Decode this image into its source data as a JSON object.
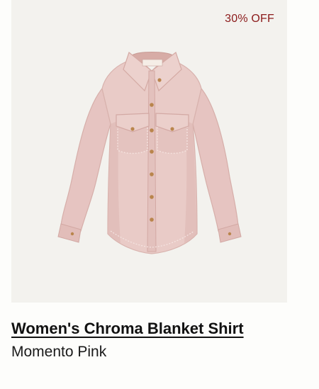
{
  "product": {
    "badge": "30% OFF",
    "title": "Women's Chroma Blanket Shirt",
    "color_name": "Momento Pink",
    "image_description_icon": "pink-button-up-shirt-image"
  },
  "colors": {
    "badge": "#8b1a1a",
    "shirt": "#e8c9c6",
    "shirt_shadow": "#d9b3af",
    "buttons": "#b8834a",
    "stitch": "#f6e8e4",
    "panel": "#f3f2ee"
  }
}
